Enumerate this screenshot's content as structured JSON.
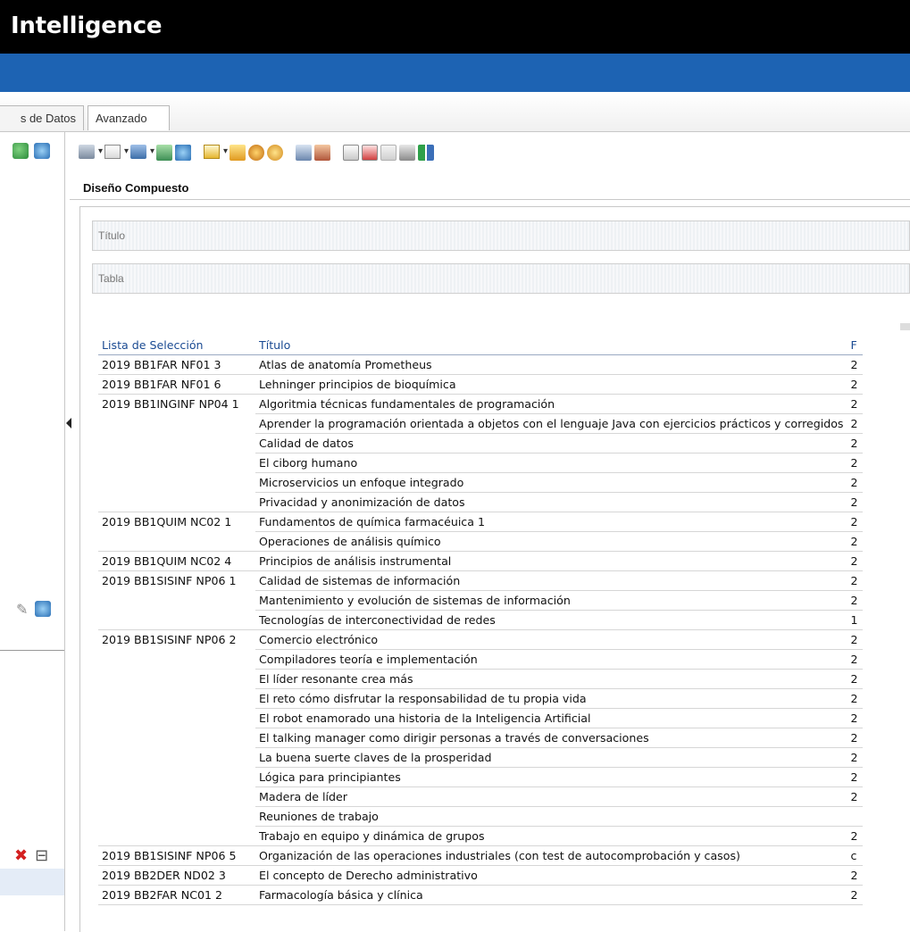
{
  "app": {
    "title": "Intelligence"
  },
  "tabs": [
    {
      "label": "s de Datos"
    },
    {
      "label": "Avanzado"
    }
  ],
  "panel": {
    "title": "Diseño Compuesto",
    "sections": [
      {
        "label": "Título"
      },
      {
        "label": "Tabla"
      }
    ]
  },
  "table": {
    "headers": [
      "Lista de Selección",
      "Título",
      "F"
    ],
    "rows": [
      [
        "2019 BB1FAR NF01 3",
        "Atlas de anatomía Prometheus",
        "2"
      ],
      [
        "2019 BB1FAR NF01 6",
        "Lehninger principios de bioquímica",
        "2"
      ],
      [
        "2019 BB1INGINF NP04 1",
        "Algoritmia técnicas fundamentales de programación",
        "2"
      ],
      [
        "",
        "Aprender la programación orientada a objetos con el lenguaje Java con ejercicios prácticos y corregidos",
        "2"
      ],
      [
        "",
        "Calidad de datos",
        "2"
      ],
      [
        "",
        "El ciborg humano",
        "2"
      ],
      [
        "",
        "Microservicios un enfoque integrado",
        "2"
      ],
      [
        "",
        "Privacidad y anonimización de datos",
        "2"
      ],
      [
        "2019 BB1QUIM NC02 1",
        "Fundamentos de química farmacéuica 1",
        "2"
      ],
      [
        "",
        "Operaciones de análisis químico",
        "2"
      ],
      [
        "2019 BB1QUIM NC02 4",
        "Principios de análisis instrumental",
        "2"
      ],
      [
        "2019 BB1SISINF NP06 1",
        "Calidad de sistemas de información",
        "2"
      ],
      [
        "",
        "Mantenimiento y evolución de sistemas de información",
        "2"
      ],
      [
        "",
        "Tecnologías de interconectividad de redes",
        "1"
      ],
      [
        "2019 BB1SISINF NP06 2",
        "Comercio electrónico",
        "2"
      ],
      [
        "",
        "Compiladores teoría e implementación",
        "2"
      ],
      [
        "",
        "El líder resonante crea más",
        "2"
      ],
      [
        "",
        "El reto cómo disfrutar la responsabilidad de tu propia vida",
        "2"
      ],
      [
        "",
        "El robot enamorado una historia de la Inteligencia Artificial",
        "2"
      ],
      [
        "",
        "El talking manager como dirigir personas a través de conversaciones",
        "2"
      ],
      [
        "",
        "La buena suerte claves de la prosperidad",
        "2"
      ],
      [
        "",
        "Lógica para principiantes",
        "2"
      ],
      [
        "",
        "Madera de líder",
        "2"
      ],
      [
        "",
        "Reuniones de trabajo",
        ""
      ],
      [
        "",
        "Trabajo en equipo y dinámica de grupos",
        "2"
      ],
      [
        "2019 BB1SISINF NP06 5",
        "Organización de las operaciones industriales (con test de autocomprobación y casos)",
        "c"
      ],
      [
        "2019 BB2DER ND02 3",
        "El concepto de Derecho administrativo",
        "2"
      ],
      [
        "2019 BB2FAR NC01 2",
        "Farmacología básica y clínica",
        "2"
      ]
    ]
  },
  "icons": {
    "toolbar": [
      "printer-icon",
      "export-icon",
      "view-icon",
      "copy-icon",
      "refresh-icon",
      "new-layout-icon",
      "edit-icon",
      "link-icon",
      "help-icon",
      "calculator-icon",
      "users-icon",
      "report-icon",
      "report-add-icon",
      "report-disabled-icon",
      "properties-icon",
      "sort-icon"
    ],
    "colors": {
      "accent": "#1d63b3",
      "header_text": "#1a4a92",
      "topbar": "#000000"
    }
  }
}
